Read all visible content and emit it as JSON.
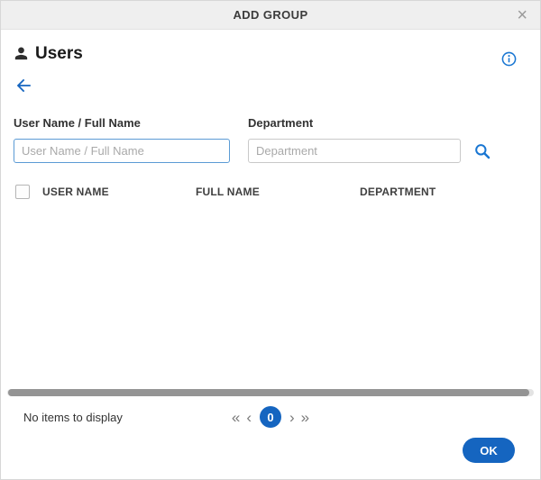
{
  "titlebar": {
    "title": "ADD GROUP",
    "close": "×"
  },
  "panel": {
    "title": "Users"
  },
  "search": {
    "username_label": "User Name / Full Name",
    "username_placeholder": "User Name / Full Name",
    "username_value": "",
    "department_label": "Department",
    "department_placeholder": "Department",
    "department_value": ""
  },
  "table": {
    "columns": {
      "username": "USER NAME",
      "fullname": "FULL NAME",
      "department": "DEPARTMENT"
    },
    "rows": []
  },
  "pagination": {
    "empty_message": "No items to display",
    "current_page": "0",
    "first_icon": "«",
    "prev_icon": "‹",
    "next_icon": "›",
    "last_icon": "»"
  },
  "footer": {
    "ok_label": "OK"
  },
  "colors": {
    "accent_blue": "#1565c0",
    "focus_border": "#5b9bd5",
    "titlebar_bg": "#efefef"
  }
}
